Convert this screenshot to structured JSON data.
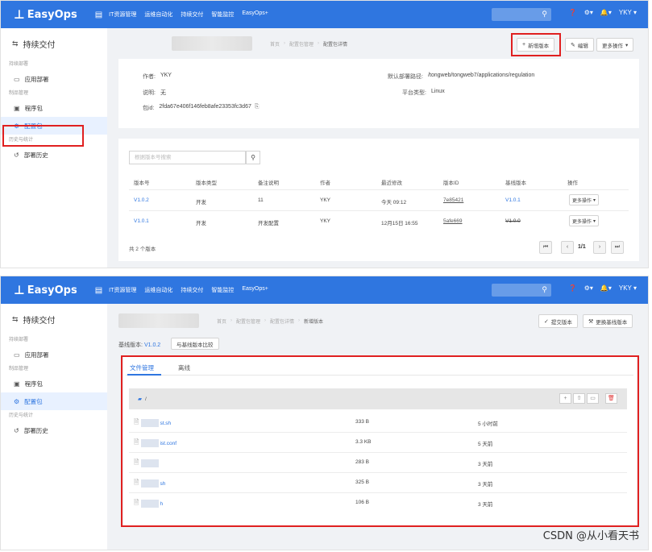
{
  "topbar": {
    "logo_text": "EasyOps",
    "nav": [
      "IT资源管理",
      "运维自动化",
      "持续交付",
      "智能监控",
      "EasyOps+"
    ],
    "user": "YKY"
  },
  "sidebar": {
    "title": "持续交付",
    "groups": {
      "deploy": "持续部署",
      "pkg": "制品管理",
      "stats": "历史与统计"
    },
    "items": {
      "app_deploy": "应用部署",
      "program_pkg": "程序包",
      "config_pkg": "配置包",
      "deploy_history": "部署历史"
    }
  },
  "screen1": {
    "breadcrumb": [
      "首页",
      "配置包管理",
      "配置包详情"
    ],
    "buttons": {
      "new_version": "新增版本",
      "edit": "编辑",
      "more": "更多操作"
    },
    "info": {
      "author_label": "作者:",
      "author": "YKY",
      "desc_label": "说明:",
      "desc": "无",
      "pkgid_label": "包id:",
      "pkgid": "2fda67e406f146feb8afe23353fc3d67",
      "deploy_path_label": "默认部署路径:",
      "deploy_path": "/tongweb/tongweb7/applications/regulation",
      "platform_label": "平台类型:",
      "platform": "Linux"
    },
    "search_placeholder": "根据版本号搜索",
    "table": {
      "headers": [
        "版本号",
        "版本类型",
        "备注说明",
        "作者",
        "最近修改",
        "版本ID",
        "基线版本",
        "操作"
      ],
      "rows": [
        [
          "V1.0.2",
          "开发",
          "11",
          "YKY",
          "今天 09:12",
          "7e85421",
          "V1.0.1",
          "更多操作"
        ],
        [
          "V1.0.1",
          "开发",
          "开发配置",
          "YKY",
          "12月15日 16:55",
          "5afe669",
          "V1.0.0",
          "更多操作"
        ]
      ]
    },
    "total": "共 2 个版本",
    "page": "1/1"
  },
  "screen2": {
    "breadcrumb": [
      "首页",
      "配置包管理",
      "配置包详情",
      "新增版本"
    ],
    "buttons": {
      "submit": "提交版本",
      "change_base": "更换基线版本"
    },
    "base_label": "基线版本:",
    "base_version": "V1.0.2",
    "compare": "与基线版本比较",
    "tabs": [
      "文件管理",
      "离线"
    ],
    "path": "/",
    "files": [
      {
        "name": "st.sh",
        "size": "333 B",
        "time": "5 小时前"
      },
      {
        "name": "ist.conf",
        "size": "3.3 KB",
        "time": "5 天前"
      },
      {
        "name": "",
        "size": "283 B",
        "time": "3 天前"
      },
      {
        "name": "sh",
        "size": "325 B",
        "time": "3 天前"
      },
      {
        "name": "h",
        "size": "106 B",
        "time": "3 天前"
      }
    ]
  },
  "watermark": "CSDN @从小看天书",
  "colors": {
    "primary": "#2f76e0",
    "highlight": "#e02020"
  }
}
